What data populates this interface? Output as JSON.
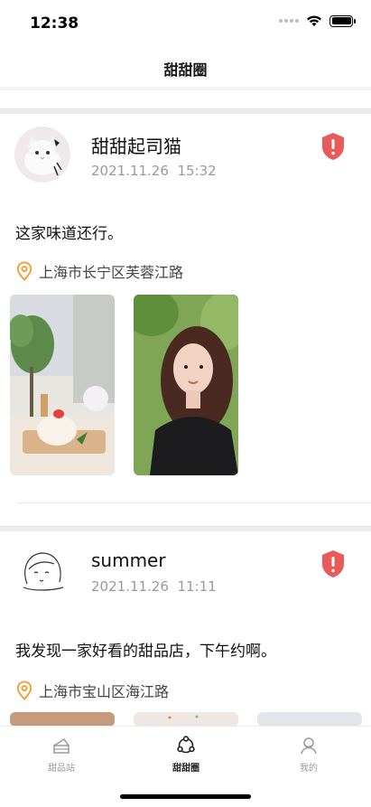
{
  "status_bar": {
    "time": "12:38"
  },
  "nav": {
    "title": "甜甜圈"
  },
  "posts": [
    {
      "username": "甜甜起司猫",
      "date": "2021.11.26",
      "time": "15:32",
      "text": "这家味道还行。",
      "location": "上海市长宁区芙蓉江路",
      "photos": [
        "dessert-photo",
        "portrait-photo"
      ]
    },
    {
      "username": "summer",
      "date": "2021.11.26",
      "time": "11:11",
      "text": "我发现一家好看的甜品店，下午约啊。",
      "location": "上海市宝山区海江路",
      "photos": [
        "photo-1",
        "photo-2",
        "photo-3"
      ]
    }
  ],
  "tabs": [
    {
      "label": "甜品站",
      "icon": "cake-icon",
      "active": false
    },
    {
      "label": "甜甜圈",
      "icon": "circle-share-icon",
      "active": true
    },
    {
      "label": "我的",
      "icon": "user-icon",
      "active": false
    }
  ],
  "colors": {
    "report": "#e95b5b",
    "location": "#f39a2b",
    "text_secondary": "#9a9a9a"
  }
}
